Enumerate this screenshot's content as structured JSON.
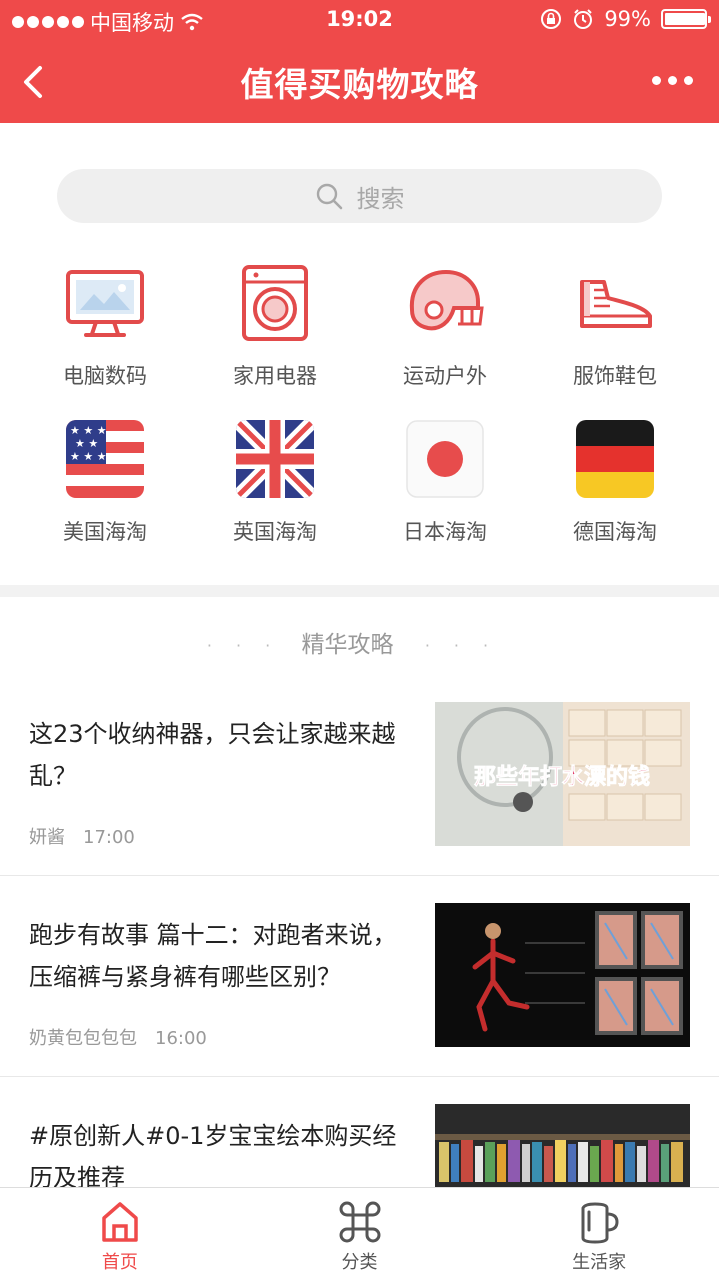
{
  "status_bar": {
    "carrier": "中国移动",
    "time": "19:02",
    "battery": "99%",
    "battery_level": 0.99
  },
  "nav": {
    "title": "值得买购物攻略",
    "back_icon": "chevron-left-icon",
    "more_icon": "more-dots-icon"
  },
  "search": {
    "placeholder": "搜索"
  },
  "categories": [
    {
      "label": "电脑数码",
      "icon": "monitor-icon"
    },
    {
      "label": "家用电器",
      "icon": "washing-machine-icon"
    },
    {
      "label": "运动户外",
      "icon": "helmet-icon"
    },
    {
      "label": "服饰鞋包",
      "icon": "sneaker-icon"
    },
    {
      "label": "美国海淘",
      "icon": "us-flag-icon"
    },
    {
      "label": "英国海淘",
      "icon": "uk-flag-icon"
    },
    {
      "label": "日本海淘",
      "icon": "japan-flag-icon"
    },
    {
      "label": "德国海淘",
      "icon": "germany-flag-icon"
    }
  ],
  "section_title": "精华攻略",
  "articles": [
    {
      "title": "这23个收纳神器，只会让家越来越乱？",
      "author": "妍酱",
      "time": "17:00",
      "thumb_text": "那些年打水漂的钱"
    },
    {
      "title": "跑步有故事 篇十二：对跑者来说，压缩裤与紧身裤有哪些区别？",
      "author": "奶黄包包包包",
      "time": "16:00"
    },
    {
      "title": "#原创新人#0-1岁宝宝绘本购买经历及推荐",
      "author": "",
      "time": ""
    }
  ],
  "tabs": [
    {
      "label": "首页",
      "icon": "home-icon",
      "active": true
    },
    {
      "label": "分类",
      "icon": "command-icon",
      "active": false
    },
    {
      "label": "生活家",
      "icon": "mug-icon",
      "active": false
    }
  ],
  "colors": {
    "brand": "#ef4a4a",
    "muted": "#999999"
  }
}
